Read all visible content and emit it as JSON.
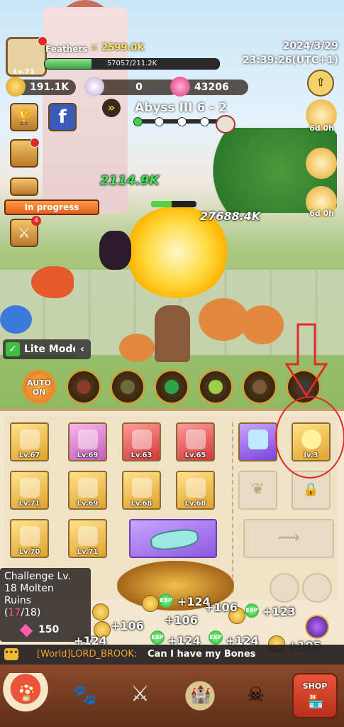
{
  "player": {
    "name": "Feathers",
    "level": "Lv.71",
    "power": "2599.0K",
    "exp_text": "57057/211.2K",
    "exp_fraction": 0.27
  },
  "datetime": {
    "date": "2024/3/29",
    "time": "23:39:26(UTC+1)"
  },
  "resources": {
    "gold": "191.1K",
    "crystals": "0",
    "gems": "43206"
  },
  "stage": {
    "label": "Abyss III  6 - 2"
  },
  "events": [
    {
      "timer": "6d 0h"
    },
    {
      "timer": "6d 0h"
    }
  ],
  "damage_numbers": {
    "left": "2114.9K",
    "right": "27688.4K"
  },
  "enemy_hp_fraction": 0.45,
  "quest": {
    "label": "In progress",
    "badge": "4"
  },
  "lite_mode": {
    "label": "Lite Mode",
    "checked": true
  },
  "skills": {
    "auto_label": "AUTO ON"
  },
  "gear_slots": [
    {
      "level": "Lv.67",
      "rarity": "gold"
    },
    {
      "level": "Lv.69",
      "rarity": "pink"
    },
    {
      "level": "Lv.63",
      "rarity": "red"
    },
    {
      "level": "Lv.65",
      "rarity": "red"
    },
    {
      "level": "Lv.71",
      "rarity": "gold"
    },
    {
      "level": "Lv.69",
      "rarity": "gold"
    },
    {
      "level": "Lv.68",
      "rarity": "gold"
    },
    {
      "level": "Lv.68",
      "rarity": "gold"
    },
    {
      "level": "Lv.70",
      "rarity": "gold"
    },
    {
      "level": "Lv.71",
      "rarity": "gold"
    }
  ],
  "special_slot": {
    "level": "lv.3"
  },
  "challenge": {
    "line1": "Challenge Lv.",
    "line2": "18 Molten",
    "line3": "Ruins",
    "progress_current": "17",
    "progress_total": "/18)",
    "progress_open": "(",
    "cost": "150"
  },
  "floating_text": [
    "+124",
    "+106",
    "+123",
    "+106",
    "+106",
    "+124",
    "+124",
    "+124",
    "+105"
  ],
  "chat": {
    "channel": "[World]LORD_BROOK:",
    "message": "Can I have my Bones"
  },
  "nav": {
    "shop_label": "SHOP"
  },
  "colors": {
    "annotation_red": "#e02a2a",
    "panel_bg": "#f3e7cf",
    "nav_bg": "#6b3820"
  }
}
